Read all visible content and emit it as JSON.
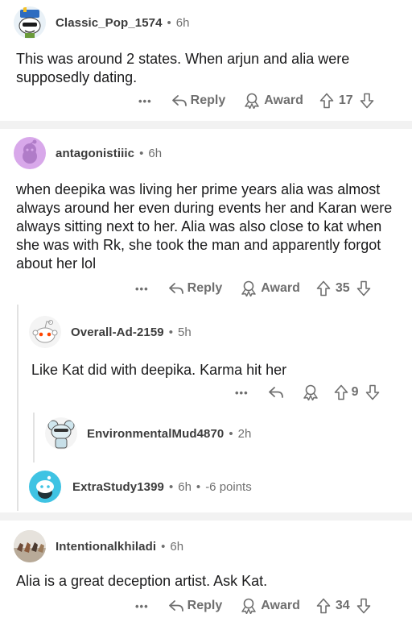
{
  "comments": [
    {
      "username": "Classic_Pop_1574",
      "time": "6h",
      "body": "This was around 2 states. When arjun and alia were supposedly dating.",
      "reply_label": "Reply",
      "award_label": "Award",
      "score": "17"
    },
    {
      "username": "antagonistiiic",
      "time": "6h",
      "body": "when deepika was living her prime years alia was almost always around her even during events her and Karan were always sitting next to her. Alia was also close to kat when she was with Rk, she took the man and apparently forgot about her lol",
      "reply_label": "Reply",
      "award_label": "Award",
      "score": "35"
    },
    {
      "username": "Overall-Ad-2159",
      "time": "5h",
      "body": "Like Kat did with deepika. Karma hit her",
      "score": "9"
    },
    {
      "username": "EnvironmentalMud4870",
      "time": "2h"
    },
    {
      "username": "ExtraStudy1399",
      "time": "6h",
      "points": "-6 points"
    },
    {
      "username": "Intentionalkhiladi",
      "time": "6h",
      "body": "Alia is a great deception artist. Ask Kat.",
      "reply_label": "Reply",
      "award_label": "Award",
      "score": "34"
    }
  ],
  "separator": "•",
  "more_icon": "•••",
  "colors": {
    "text": "#1a1a1b",
    "meta": "#6f6f6f",
    "divider": "#f2f2f2",
    "avatar_purple": "#d8a8ea",
    "avatar_teal": "#3fc3e3"
  },
  "icons": [
    "reply-arrow-icon",
    "award-icon",
    "upvote-icon",
    "downvote-icon",
    "more-icon"
  ]
}
